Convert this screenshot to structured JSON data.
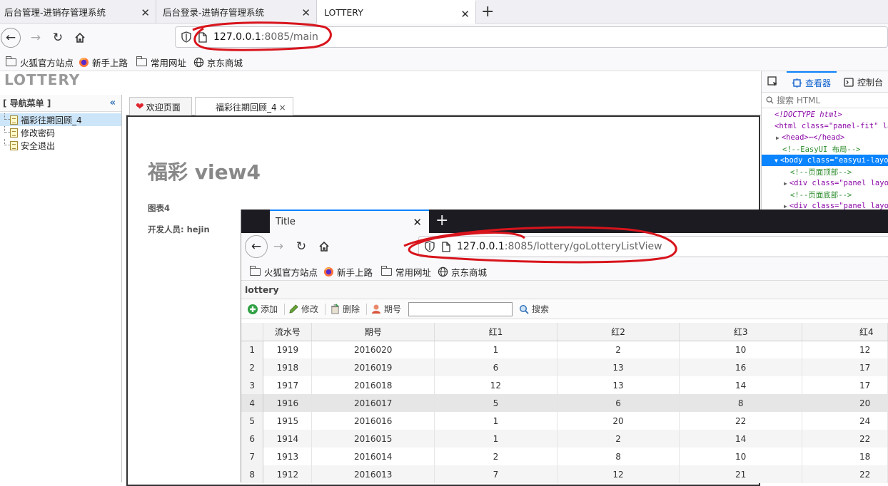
{
  "main_browser": {
    "tabs": [
      {
        "label": "后台管理-进销存管理系统"
      },
      {
        "label": "后台登录-进销存管理系统"
      },
      {
        "label": "LOTTERY"
      }
    ],
    "url": {
      "host": "127.0.0.1",
      "rest": ":8085/main"
    },
    "bookmarks": [
      {
        "label": "火狐官方站点"
      },
      {
        "label": "新手上路"
      },
      {
        "label": "常用网址"
      },
      {
        "label": "京东商城"
      }
    ]
  },
  "app": {
    "logo": "LOTTERY",
    "nav_title": "[ 导航菜单 ]",
    "nav_items": [
      {
        "label": "福彩往期回顾_4",
        "selected": true
      },
      {
        "label": "修改密码"
      },
      {
        "label": "安全退出"
      }
    ],
    "tabs": [
      {
        "label": "欢迎页面"
      },
      {
        "label": "福彩往期回顾_4"
      }
    ],
    "tab_close": "×",
    "heading": "福彩 view4",
    "chart_label": "图表4",
    "developer": "开发人员: hejin"
  },
  "devtools": {
    "inspector_label": "查看器",
    "console_label": "控制台",
    "search_placeholder": "搜索 HTML",
    "lines": [
      {
        "text": "<!DOCTYPE html>"
      },
      {
        "text": "<html class=\"panel-fit\" lan"
      },
      {
        "text": "<head>⋯</head>"
      },
      {
        "text": "<!--EasyUI 布局-->"
      },
      {
        "text": "<body class=\"easyui-layou"
      },
      {
        "text": "<!--页面顶部-->"
      },
      {
        "text": "<div class=\"panel layou"
      },
      {
        "text": "<!--页面底部-->"
      },
      {
        "text": "<div class=\"panel layou"
      }
    ]
  },
  "popup_browser": {
    "tab_title": "Title",
    "url": {
      "host": "127.0.0.1",
      "rest": ":8085/lottery/goLotteryListView"
    },
    "bookmarks": [
      {
        "label": "火狐官方站点"
      },
      {
        "label": "新手上路"
      },
      {
        "label": "常用网址"
      },
      {
        "label": "京东商城"
      }
    ],
    "page_title": "lottery",
    "toolbar": {
      "add": "添加",
      "edit": "修改",
      "delete": "删除",
      "period_label": "期号",
      "search": "搜索"
    },
    "grid": {
      "columns": [
        "流水号",
        "期号",
        "红1",
        "红2",
        "红3",
        "红4"
      ],
      "rows": [
        {
          "n": "1",
          "cells": [
            "1919",
            "2016020",
            "1",
            "2",
            "10",
            "12"
          ]
        },
        {
          "n": "2",
          "cells": [
            "1918",
            "2016019",
            "6",
            "13",
            "16",
            "17"
          ]
        },
        {
          "n": "3",
          "cells": [
            "1917",
            "2016018",
            "12",
            "13",
            "14",
            "17"
          ]
        },
        {
          "n": "4",
          "cells": [
            "1916",
            "2016017",
            "5",
            "6",
            "8",
            "20"
          ]
        },
        {
          "n": "5",
          "cells": [
            "1915",
            "2016016",
            "1",
            "20",
            "22",
            "24"
          ]
        },
        {
          "n": "6",
          "cells": [
            "1914",
            "2016015",
            "1",
            "2",
            "14",
            "22"
          ]
        },
        {
          "n": "7",
          "cells": [
            "1913",
            "2016014",
            "2",
            "8",
            "10",
            "18"
          ]
        },
        {
          "n": "8",
          "cells": [
            "1912",
            "2016013",
            "7",
            "12",
            "21",
            "22"
          ]
        }
      ]
    }
  },
  "colors": {
    "annotation_red": "#d8141c",
    "selection_blue": "#0a84ff",
    "nav_selected": "#cde5f8"
  }
}
